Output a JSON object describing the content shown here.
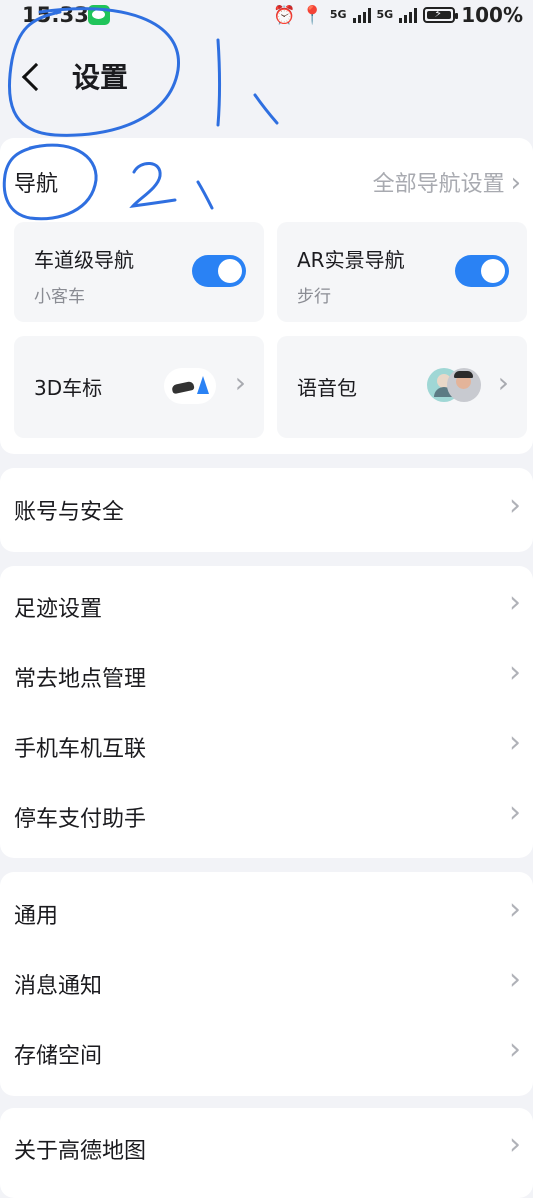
{
  "status_bar": {
    "time": "15:33",
    "net1": "5G",
    "net2": "5G",
    "battery": "100%"
  },
  "header": {
    "title": "设置"
  },
  "navigation": {
    "title": "导航",
    "all_settings": "全部导航设置",
    "cards": {
      "lane_nav": {
        "title": "车道级导航",
        "subtitle": "小客车",
        "enabled": true
      },
      "ar_nav": {
        "title": "AR实景导航",
        "subtitle": "步行",
        "enabled": true
      },
      "car_icon": {
        "title": "3D车标"
      },
      "voice_pack": {
        "title": "语音包"
      }
    }
  },
  "menu": {
    "account": "账号与安全",
    "footprint": "足迹设置",
    "frequent_places": "常去地点管理",
    "phone_car": "手机车机互联",
    "parking_pay": "停车支付助手",
    "general": "通用",
    "notifications": "消息通知",
    "storage": "存储空间",
    "about": "关于高德地图"
  },
  "colors": {
    "accent": "#2a82f4",
    "annotation": "#2f6fe0"
  }
}
